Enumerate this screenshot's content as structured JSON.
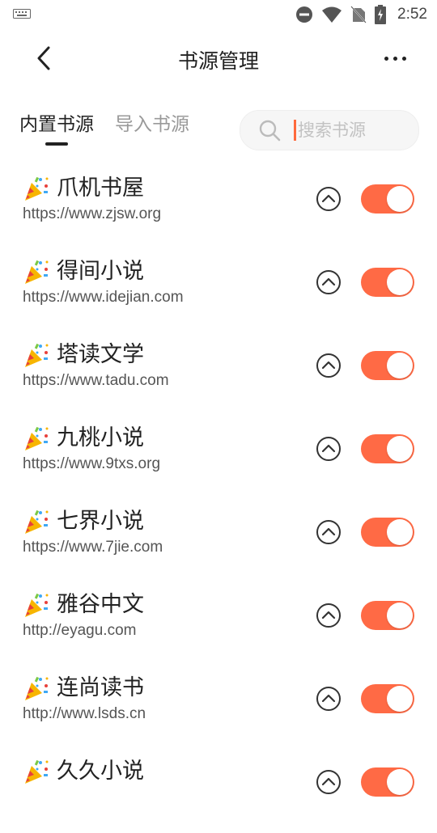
{
  "status_bar": {
    "time": "2:52"
  },
  "header": {
    "title": "书源管理"
  },
  "tabs": [
    {
      "label": "内置书源",
      "active": true
    },
    {
      "label": "导入书源",
      "active": false
    }
  ],
  "search": {
    "placeholder": "搜索书源",
    "value": ""
  },
  "colors": {
    "accent": "#ff6a45"
  },
  "sources": [
    {
      "name": "爪机书屋",
      "url": "https://www.zjsw.org",
      "enabled": true
    },
    {
      "name": "得间小说",
      "url": "https://www.idejian.com",
      "enabled": true
    },
    {
      "name": "塔读文学",
      "url": "https://www.tadu.com",
      "enabled": true
    },
    {
      "name": "九桃小说",
      "url": "https://www.9txs.org",
      "enabled": true
    },
    {
      "name": "七界小说",
      "url": "https://www.7jie.com",
      "enabled": true
    },
    {
      "name": "雅谷中文",
      "url": "http://eyagu.com",
      "enabled": true
    },
    {
      "name": "连尚读书",
      "url": "http://www.lsds.cn",
      "enabled": true
    },
    {
      "name": "久久小说",
      "url": "",
      "enabled": true
    }
  ]
}
